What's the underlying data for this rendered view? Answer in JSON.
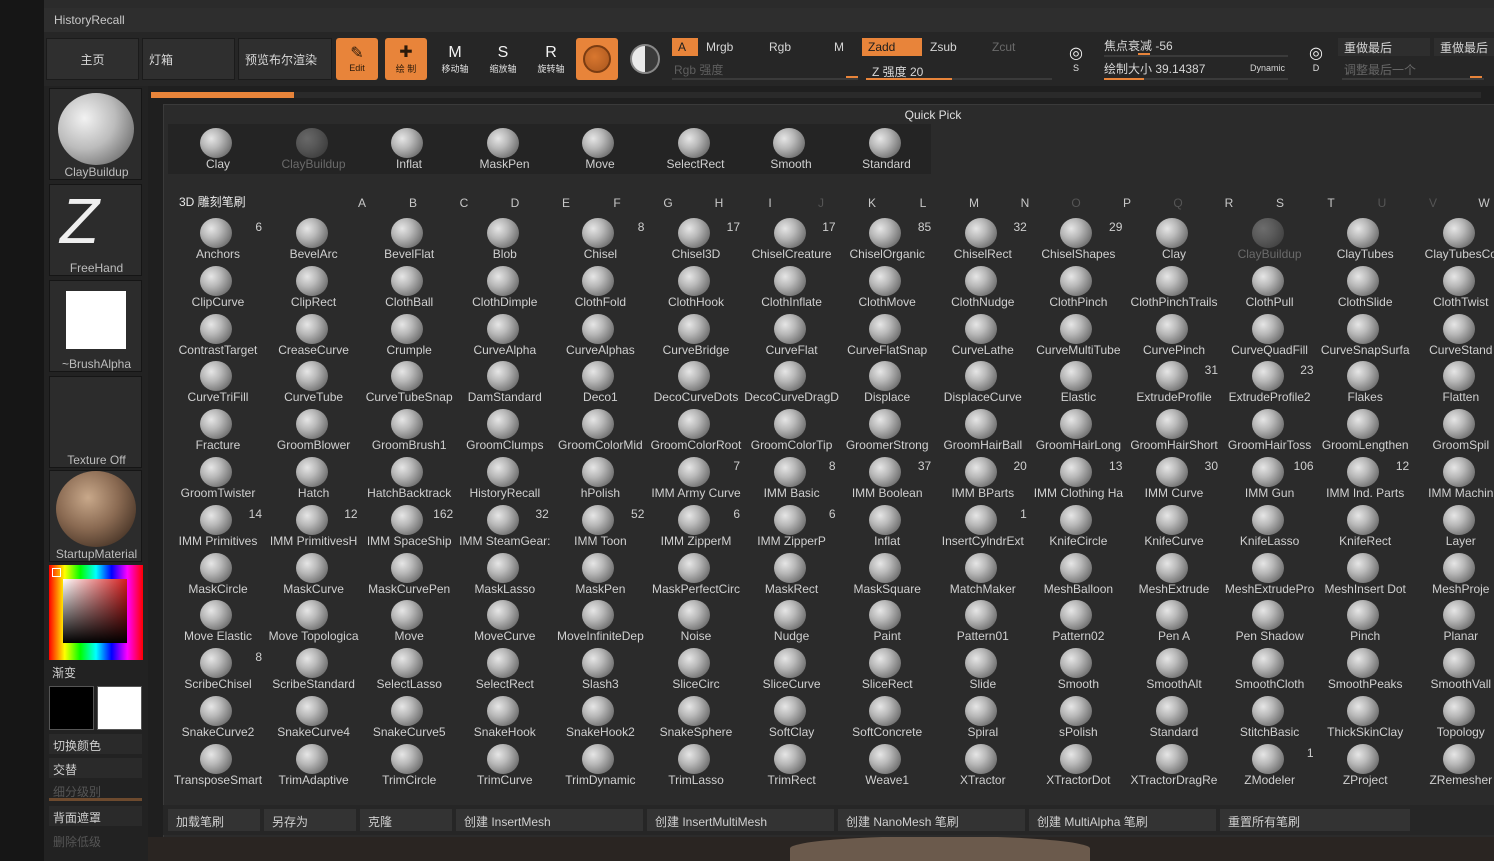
{
  "window_title": "HistoryRecall",
  "toolbar": {
    "home": "主页",
    "lightbox": "灯箱",
    "preview": "预览布尔渲染",
    "tools": [
      {
        "label": "Edit",
        "icon": "edit-icon",
        "active": true
      },
      {
        "label": "绘 制",
        "icon": "draw-icon",
        "active": true
      },
      {
        "label": "移动轴",
        "icon": "move-icon",
        "active": false
      },
      {
        "label": "缩放轴",
        "icon": "scale-icon",
        "active": false
      },
      {
        "label": "旋转轴",
        "icon": "rotate-icon",
        "active": false
      }
    ],
    "a_label": "A",
    "mrgb": "Mrgb",
    "rgb": "Rgb",
    "m": "M",
    "zadd": "Zadd",
    "zsub": "Zsub",
    "zcut": "Zcut",
    "rgb_intensity": "Rgb 强度",
    "z_intensity": "Z 强度 20",
    "focal_shift": "焦点衰减 -56",
    "draw_size": "绘制大小 39.14387",
    "dynamic": "Dynamic",
    "redo_last": "重做最后",
    "adjust_last": "调整最后一个",
    "redo_last2": "重做最后",
    "s_label": "S",
    "d_label": "D"
  },
  "left_panel": {
    "brush_name": "ClayBuildup",
    "stroke_name": "FreeHand",
    "alpha_name": "~BrushAlpha",
    "texture_name": "Texture Off",
    "material_name": "StartupMaterial",
    "gradient_label": "渐变",
    "switch_color": "切换颜色",
    "alternate": "交替",
    "subdiv": "细分级别",
    "back_mask": "背面遮罩",
    "delete_lower": "删除低级"
  },
  "quick_pick": {
    "title": "Quick Pick",
    "items": [
      {
        "name": "Clay",
        "dim": false
      },
      {
        "name": "ClayBuildup",
        "dim": true
      },
      {
        "name": "Inflat",
        "dim": false
      },
      {
        "name": "MaskPen",
        "dim": false
      },
      {
        "name": "Move",
        "dim": false
      },
      {
        "name": "SelectRect",
        "dim": false
      },
      {
        "name": "Smooth",
        "dim": false
      },
      {
        "name": "Standard",
        "dim": false
      }
    ]
  },
  "grid": {
    "title": "3D 雕刻笔刷",
    "letters": [
      {
        "l": "A",
        "dim": false
      },
      {
        "l": "B",
        "dim": false
      },
      {
        "l": "C",
        "dim": false
      },
      {
        "l": "D",
        "dim": false
      },
      {
        "l": "E",
        "dim": false
      },
      {
        "l": "F",
        "dim": false
      },
      {
        "l": "G",
        "dim": false
      },
      {
        "l": "H",
        "dim": false
      },
      {
        "l": "I",
        "dim": false
      },
      {
        "l": "J",
        "dim": true
      },
      {
        "l": "K",
        "dim": false
      },
      {
        "l": "L",
        "dim": false
      },
      {
        "l": "M",
        "dim": false
      },
      {
        "l": "N",
        "dim": false
      },
      {
        "l": "O",
        "dim": true
      },
      {
        "l": "P",
        "dim": false
      },
      {
        "l": "Q",
        "dim": true
      },
      {
        "l": "R",
        "dim": false
      },
      {
        "l": "S",
        "dim": false
      },
      {
        "l": "T",
        "dim": false
      },
      {
        "l": "U",
        "dim": true
      },
      {
        "l": "V",
        "dim": true
      },
      {
        "l": "W",
        "dim": false
      }
    ],
    "rows": [
      [
        [
          "Anchors",
          "6"
        ],
        [
          "BevelArc",
          ""
        ],
        [
          "BevelFlat",
          ""
        ],
        [
          "Blob",
          ""
        ],
        [
          "Chisel",
          "8"
        ],
        [
          "Chisel3D",
          "17"
        ],
        [
          "ChiselCreature",
          "17"
        ],
        [
          "ChiselOrganic",
          "85"
        ],
        [
          "ChiselRect",
          "32"
        ],
        [
          "ChiselShapes",
          "29"
        ],
        [
          "Clay",
          ""
        ],
        [
          "ClayBuildup",
          "",
          true
        ],
        [
          "ClayTubes",
          ""
        ],
        [
          "ClayTubesCo",
          ""
        ]
      ],
      [
        [
          "ClipCurve",
          ""
        ],
        [
          "ClipRect",
          ""
        ],
        [
          "ClothBall",
          ""
        ],
        [
          "ClothDimple",
          ""
        ],
        [
          "ClothFold",
          ""
        ],
        [
          "ClothHook",
          ""
        ],
        [
          "ClothInflate",
          ""
        ],
        [
          "ClothMove",
          ""
        ],
        [
          "ClothNudge",
          ""
        ],
        [
          "ClothPinch",
          ""
        ],
        [
          "ClothPinchTrails",
          ""
        ],
        [
          "ClothPull",
          ""
        ],
        [
          "ClothSlide",
          ""
        ],
        [
          "ClothTwist",
          ""
        ]
      ],
      [
        [
          "ContrastTarget",
          ""
        ],
        [
          "CreaseCurve",
          ""
        ],
        [
          "Crumple",
          ""
        ],
        [
          "CurveAlpha",
          ""
        ],
        [
          "CurveAlphas",
          ""
        ],
        [
          "CurveBridge",
          ""
        ],
        [
          "CurveFlat",
          ""
        ],
        [
          "CurveFlatSnap",
          ""
        ],
        [
          "CurveLathe",
          ""
        ],
        [
          "CurveMultiTube",
          ""
        ],
        [
          "CurvePinch",
          ""
        ],
        [
          "CurveQuadFill",
          ""
        ],
        [
          "CurveSnapSurfa",
          ""
        ],
        [
          "CurveStand",
          ""
        ]
      ],
      [
        [
          "CurveTriFill",
          ""
        ],
        [
          "CurveTube",
          ""
        ],
        [
          "CurveTubeSnap",
          ""
        ],
        [
          "DamStandard",
          ""
        ],
        [
          "Deco1",
          ""
        ],
        [
          "DecoCurveDots",
          ""
        ],
        [
          "DecoCurveDragD",
          ""
        ],
        [
          "Displace",
          ""
        ],
        [
          "DisplaceCurve",
          ""
        ],
        [
          "Elastic",
          ""
        ],
        [
          "ExtrudeProfile",
          "31"
        ],
        [
          "ExtrudeProfile2",
          "23"
        ],
        [
          "Flakes",
          ""
        ],
        [
          "Flatten",
          ""
        ]
      ],
      [
        [
          "Fracture",
          ""
        ],
        [
          "GroomBlower",
          ""
        ],
        [
          "GroomBrush1",
          ""
        ],
        [
          "GroomClumps",
          ""
        ],
        [
          "GroomColorMid",
          ""
        ],
        [
          "GroomColorRoot",
          ""
        ],
        [
          "GroomColorTip",
          ""
        ],
        [
          "GroomerStrong",
          ""
        ],
        [
          "GroomHairBall",
          ""
        ],
        [
          "GroomHairLong",
          ""
        ],
        [
          "GroomHairShort",
          ""
        ],
        [
          "GroomHairToss",
          ""
        ],
        [
          "GroomLengthen",
          ""
        ],
        [
          "GroomSpil",
          ""
        ]
      ],
      [
        [
          "GroomTwister",
          ""
        ],
        [
          "Hatch",
          ""
        ],
        [
          "HatchBacktrack",
          ""
        ],
        [
          "HistoryRecall",
          ""
        ],
        [
          "hPolish",
          ""
        ],
        [
          "IMM Army Curve",
          "7"
        ],
        [
          "IMM Basic",
          "8"
        ],
        [
          "IMM Boolean",
          "37"
        ],
        [
          "IMM BParts",
          "20"
        ],
        [
          "IMM Clothing Ha",
          "13"
        ],
        [
          "IMM Curve",
          "30"
        ],
        [
          "IMM Gun",
          "106"
        ],
        [
          "IMM Ind. Parts",
          "12"
        ],
        [
          "IMM Machin",
          ""
        ]
      ],
      [
        [
          "IMM Primitives",
          "14"
        ],
        [
          "IMM PrimitivesH",
          "12"
        ],
        [
          "IMM SpaceShip",
          "162"
        ],
        [
          "IMM SteamGear:",
          "32"
        ],
        [
          "IMM Toon",
          "52"
        ],
        [
          "IMM ZipperM",
          "6"
        ],
        [
          "IMM ZipperP",
          "6"
        ],
        [
          "Inflat",
          ""
        ],
        [
          "InsertCylndrExt",
          "1"
        ],
        [
          "KnifeCircle",
          ""
        ],
        [
          "KnifeCurve",
          ""
        ],
        [
          "KnifeLasso",
          ""
        ],
        [
          "KnifeRect",
          ""
        ],
        [
          "Layer",
          ""
        ]
      ],
      [
        [
          "MaskCircle",
          ""
        ],
        [
          "MaskCurve",
          ""
        ],
        [
          "MaskCurvePen",
          ""
        ],
        [
          "MaskLasso",
          ""
        ],
        [
          "MaskPen",
          ""
        ],
        [
          "MaskPerfectCirc",
          ""
        ],
        [
          "MaskRect",
          ""
        ],
        [
          "MaskSquare",
          ""
        ],
        [
          "MatchMaker",
          ""
        ],
        [
          "MeshBalloon",
          ""
        ],
        [
          "MeshExtrude",
          ""
        ],
        [
          "MeshExtrudePro",
          ""
        ],
        [
          "MeshInsert Dot",
          ""
        ],
        [
          "MeshProje",
          ""
        ]
      ],
      [
        [
          "Move Elastic",
          ""
        ],
        [
          "Move Topologica",
          ""
        ],
        [
          "Move",
          ""
        ],
        [
          "MoveCurve",
          ""
        ],
        [
          "MoveInfiniteDep",
          ""
        ],
        [
          "Noise",
          ""
        ],
        [
          "Nudge",
          ""
        ],
        [
          "Paint",
          ""
        ],
        [
          "Pattern01",
          ""
        ],
        [
          "Pattern02",
          ""
        ],
        [
          "Pen A",
          ""
        ],
        [
          "Pen Shadow",
          ""
        ],
        [
          "Pinch",
          ""
        ],
        [
          "Planar",
          ""
        ]
      ],
      [
        [
          "ScribeChisel",
          "8"
        ],
        [
          "ScribeStandard",
          ""
        ],
        [
          "SelectLasso",
          ""
        ],
        [
          "SelectRect",
          ""
        ],
        [
          "Slash3",
          ""
        ],
        [
          "SliceCirc",
          ""
        ],
        [
          "SliceCurve",
          ""
        ],
        [
          "SliceRect",
          ""
        ],
        [
          "Slide",
          ""
        ],
        [
          "Smooth",
          ""
        ],
        [
          "SmoothAlt",
          ""
        ],
        [
          "SmoothCloth",
          ""
        ],
        [
          "SmoothPeaks",
          ""
        ],
        [
          "SmoothVall",
          ""
        ]
      ],
      [
        [
          "SnakeCurve2",
          ""
        ],
        [
          "SnakeCurve4",
          ""
        ],
        [
          "SnakeCurve5",
          ""
        ],
        [
          "SnakeHook",
          ""
        ],
        [
          "SnakeHook2",
          ""
        ],
        [
          "SnakeSphere",
          ""
        ],
        [
          "SoftClay",
          ""
        ],
        [
          "SoftConcrete",
          ""
        ],
        [
          "Spiral",
          ""
        ],
        [
          "sPolish",
          ""
        ],
        [
          "Standard",
          ""
        ],
        [
          "StitchBasic",
          ""
        ],
        [
          "ThickSkinClay",
          ""
        ],
        [
          "Topology",
          ""
        ]
      ],
      [
        [
          "TransposeSmart",
          ""
        ],
        [
          "TrimAdaptive",
          ""
        ],
        [
          "TrimCircle",
          ""
        ],
        [
          "TrimCurve",
          ""
        ],
        [
          "TrimDynamic",
          ""
        ],
        [
          "TrimLasso",
          ""
        ],
        [
          "TrimRect",
          ""
        ],
        [
          "Weave1",
          ""
        ],
        [
          "XTractor",
          ""
        ],
        [
          "XTractorDot",
          ""
        ],
        [
          "XTractorDragRe",
          ""
        ],
        [
          "ZModeler",
          "1"
        ],
        [
          "ZProject",
          ""
        ],
        [
          "ZRemesher",
          ""
        ]
      ]
    ]
  },
  "bottom_buttons": [
    "加载笔刷",
    "另存为",
    "克隆",
    "创建 InsertMesh",
    "创建 InsertMultiMesh",
    "创建 NanoMesh 笔刷",
    "创建 MultiAlpha 笔刷",
    "重置所有笔刷"
  ],
  "colors": {
    "accent": "#e8843a",
    "panel": "#2b2b2b",
    "background": "#1f1f1f"
  }
}
